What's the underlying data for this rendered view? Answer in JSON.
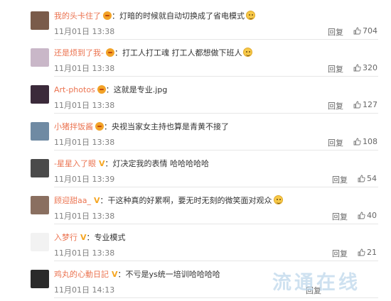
{
  "comments": [
    {
      "username": "我的头卡住了",
      "vip": "",
      "content": "：灯暗的时候就自动切换成了省电模式",
      "time": "11月01日 13:38",
      "reply": "回复",
      "likes": "704",
      "avatar_color": "#7a5b4a",
      "has_emoji": true
    },
    {
      "username": "还是烦到了我-",
      "vip": "",
      "content": "：打工人打工魂 打工人都想做下班人",
      "time": "11月01日 13:38",
      "reply": "回复",
      "likes": "320",
      "avatar_color": "#c9b7c8",
      "has_emoji": true
    },
    {
      "username": "Art-photos",
      "vip": "",
      "content": "：这就是专业.jpg",
      "time": "11月01日 13:38",
      "reply": "回复",
      "likes": "127",
      "avatar_color": "#3b2a3a",
      "has_emoji": false
    },
    {
      "username": "小猪拌饭酱",
      "vip": "",
      "content": "：央视当家女主持也算是青黄不接了",
      "time": "11月01日 13:38",
      "reply": "回复",
      "likes": "108",
      "avatar_color": "#6f8aa3",
      "has_emoji": false
    },
    {
      "username": "-星星入了眼",
      "vip": "V",
      "content": "：灯决定我的表情 哈哈哈哈哈",
      "time": "11月01日 13:39",
      "reply": "回复",
      "likes": "54",
      "avatar_color": "#4a4a4a",
      "has_emoji": false
    },
    {
      "username": "顾迎甜aa_",
      "vip": "V",
      "content": "：干这种真的好累啊，要无时无刻的微笑面对观众",
      "time": "11月01日 13:38",
      "reply": "回复",
      "likes": "40",
      "avatar_color": "#8a6f60",
      "has_emoji": true
    },
    {
      "username": "入梦行",
      "vip": "V",
      "content": "：专业模式",
      "time": "11月01日 13:38",
      "reply": "回复",
      "likes": "21",
      "avatar_color": "#f2f2f2",
      "has_emoji": false
    },
    {
      "username": "鸡丸的心動日記",
      "vip": "V",
      "content": "：不亏是ys统一培训哈哈哈哈",
      "time": "11月01日 14:13",
      "reply": "回复",
      "likes": "",
      "avatar_color": "#2a2a2a",
      "has_emoji": false
    }
  ],
  "watermark": "流通在线",
  "colors": {
    "username": "#eb7350",
    "time": "#808080",
    "vip": "#f5a623"
  }
}
